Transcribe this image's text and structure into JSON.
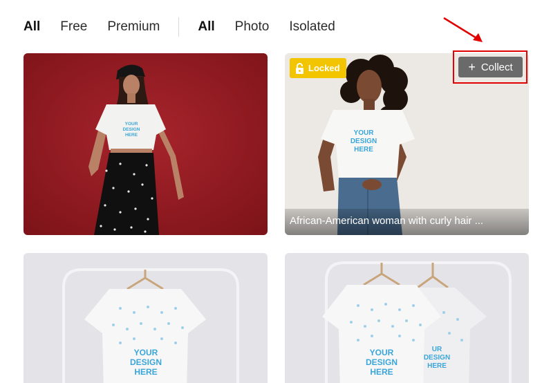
{
  "filters": {
    "group1": [
      "All",
      "Free",
      "Premium"
    ],
    "group2": [
      "All",
      "Photo",
      "Isolated"
    ]
  },
  "cards": [
    {
      "print": [
        "YOUR",
        "DESIGN",
        "HERE"
      ]
    },
    {
      "badge": "Locked",
      "collect": "Collect",
      "caption": "African-American woman with curly hair ...",
      "print": [
        "YOUR",
        "DESIGN",
        "HERE"
      ]
    },
    {
      "print": [
        "YOUR",
        "DESIGN",
        "HERE"
      ]
    },
    {
      "print": [
        "YOUR",
        "DESIGN",
        "HERE"
      ],
      "print_back": [
        "UR",
        "DESIGN",
        "HERE"
      ]
    }
  ],
  "colors": {
    "accent": "#e30000",
    "badge": "#f3c400",
    "collect_bg": "#6a6a6a",
    "print": "#3aa6d8"
  },
  "icons": [
    "lock-icon",
    "plus-icon",
    "arrow-annotation"
  ]
}
